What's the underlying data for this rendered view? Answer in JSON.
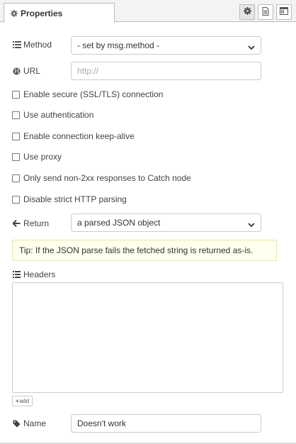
{
  "tab": {
    "title": "Properties"
  },
  "method": {
    "label": "Method",
    "value": "- set by msg.method -"
  },
  "url": {
    "label": "URL",
    "placeholder": "http://"
  },
  "options": [
    {
      "label": "Enable secure (SSL/TLS) connection"
    },
    {
      "label": "Use authentication"
    },
    {
      "label": "Enable connection keep-alive"
    },
    {
      "label": "Use proxy"
    },
    {
      "label": "Only send non-2xx responses to Catch node"
    },
    {
      "label": "Disable strict HTTP parsing"
    }
  ],
  "ret": {
    "label": "Return",
    "value": "a parsed JSON object"
  },
  "tip": "Tip: If the JSON parse fails the fetched string is returned as-is.",
  "headers": {
    "label": "Headers",
    "add_label": "add"
  },
  "name": {
    "label": "Name",
    "value": "Doesn't work"
  },
  "icons": {
    "tab": "cog-icon",
    "settings": "cog-icon",
    "description": "file-icon",
    "appearance": "window-icon",
    "method": "list-icon",
    "url": "globe-icon",
    "ret": "arrow-left-icon",
    "headers": "list-icon",
    "name": "tag-icon",
    "add": "plus-icon"
  }
}
